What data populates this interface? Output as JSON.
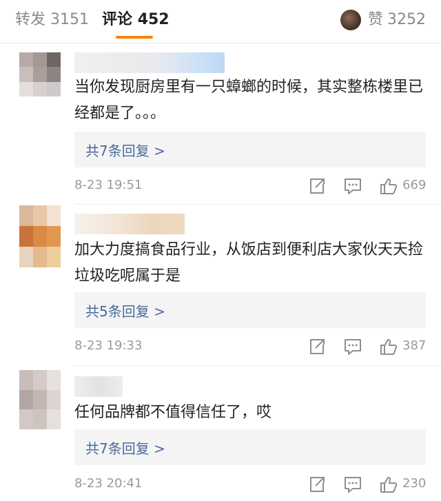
{
  "tabs": {
    "repost_label": "转发",
    "repost_count": "3151",
    "comment_label": "评论",
    "comment_count": "452",
    "like_label": "赞",
    "like_count": "3252"
  },
  "colors": {
    "accent": "#ff8200",
    "reply_link": "#4a6a9a",
    "meta": "#9a9a9a"
  },
  "comments": [
    {
      "text": "当你发现厨房里有一只蟑螂的时候，其实整栋楼里已经都是了。。。",
      "replies_label": "共7条回复 >",
      "time": "8-23 19:51",
      "likes": "669"
    },
    {
      "text": "加大力度搞食品行业，从饭店到便利店大家伙天天捡垃圾吃呢属于是",
      "replies_label": "共5条回复 >",
      "time": "8-23 19:33",
      "likes": "387"
    },
    {
      "text": "任何品牌都不值得信任了，哎",
      "replies_label": "共7条回复 >",
      "time": "8-23 20:41",
      "likes": "230"
    }
  ],
  "icons": [
    "share-icon",
    "reply-icon",
    "thumbs-up-icon"
  ]
}
